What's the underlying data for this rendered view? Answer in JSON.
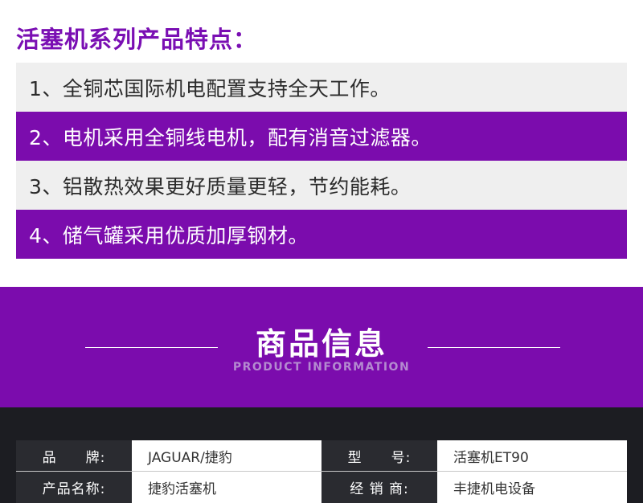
{
  "features": {
    "title": "活塞机系列产品特点：",
    "items": [
      "1、全铜芯国际机电配置支持全天工作。",
      "2、电机采用全铜线电机，配有消音过滤器。",
      "3、铝散热效果更好质量更轻，节约能耗。",
      "4、储气罐采用优质加厚钢材。"
    ]
  },
  "banner": {
    "title": "商品信息",
    "subtitle": "PRODUCT INFORMATION"
  },
  "info": {
    "rows": [
      [
        {
          "label": "品　　牌:",
          "value": "JAGUAR/捷豹"
        },
        {
          "label": "型　　号:",
          "value": "活塞机ET90"
        }
      ],
      [
        {
          "label": "产品名称:",
          "value": "捷豹活塞机"
        },
        {
          "label": "经 销 商:",
          "value": "丰捷机电设备"
        }
      ]
    ]
  },
  "colors": {
    "accent_purple": "#7b0cad",
    "title_purple": "#7a0fb3",
    "dark_bg": "#1c1d22"
  }
}
